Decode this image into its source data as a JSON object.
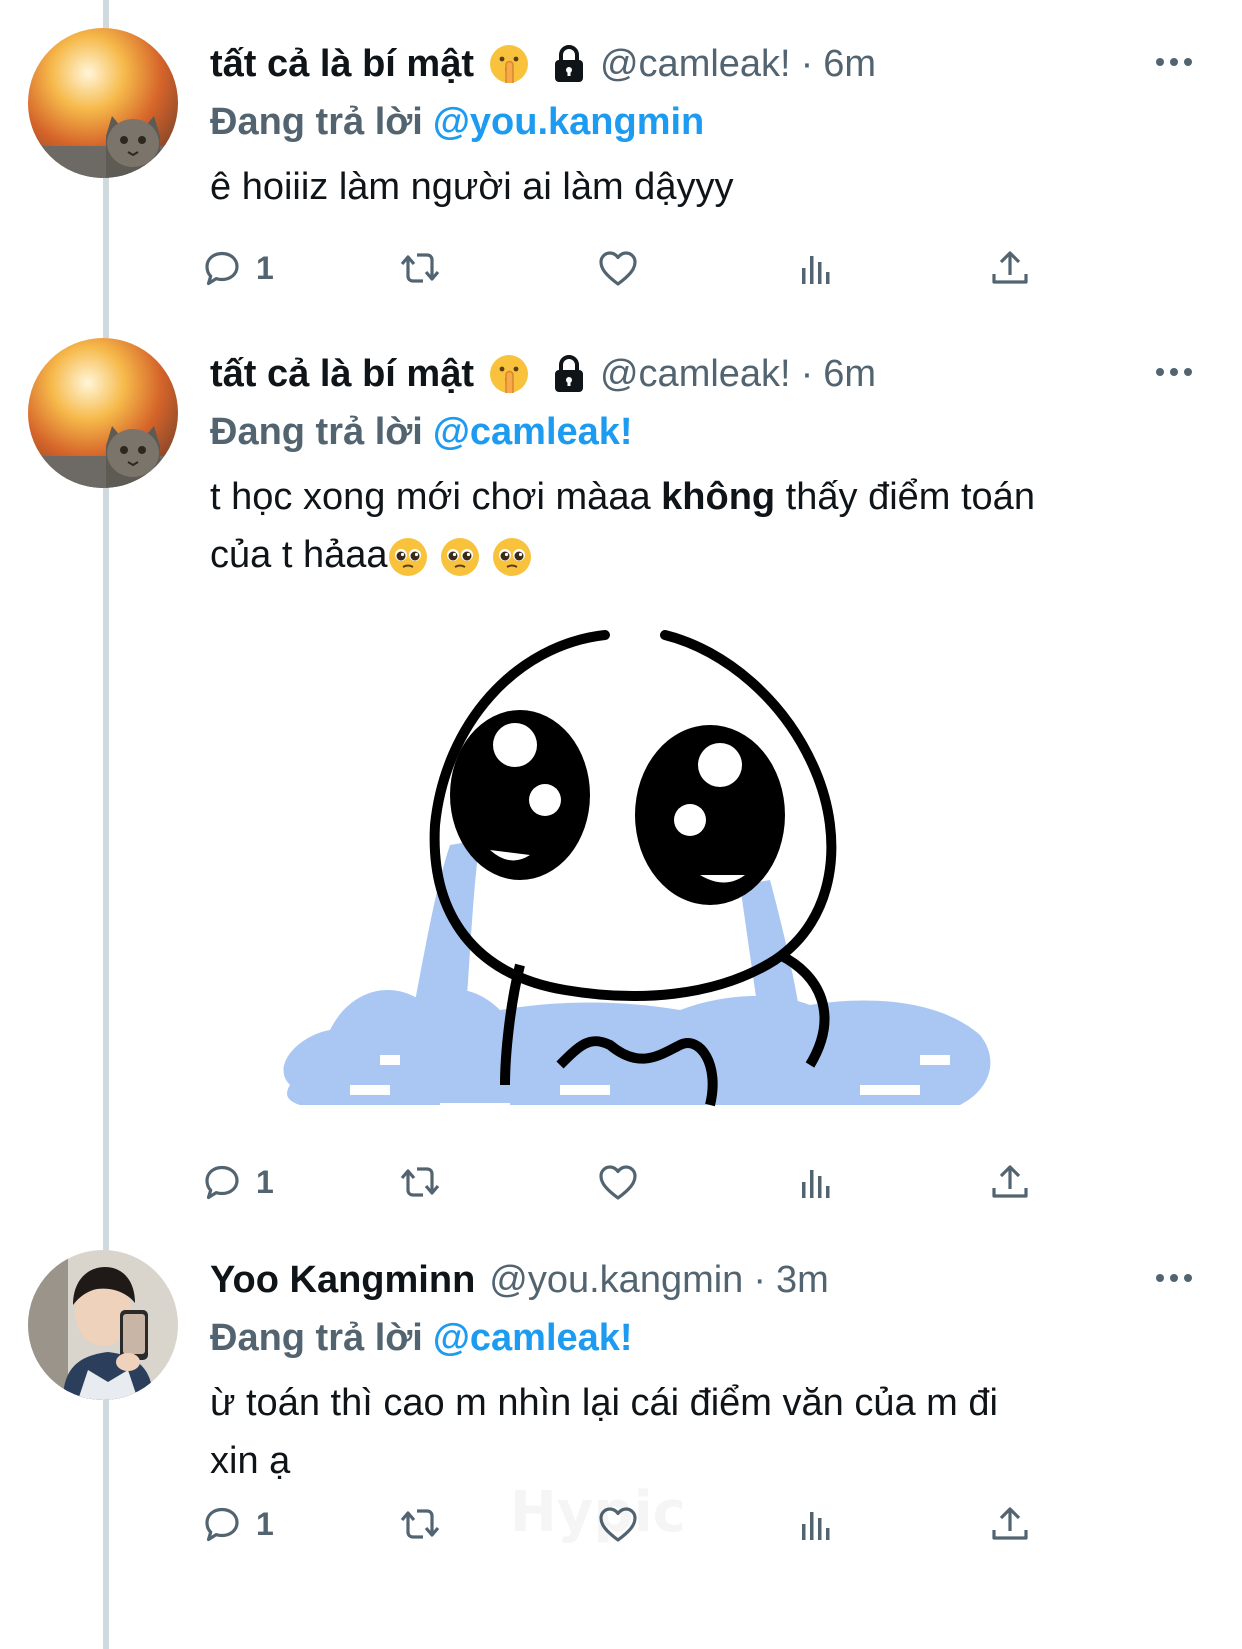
{
  "tweets": [
    {
      "display_name": "tất cả là bí mật",
      "emoji": "shushing-face",
      "protected": true,
      "handle": "@camleak!",
      "separator": "·",
      "time": "6m",
      "reply_prefix": "Đang trả lời",
      "reply_to": "@you.kangmin",
      "text": "ê hoiiiz làm người ai làm dậyyy",
      "reply_count": "1"
    },
    {
      "display_name": "tất cả là bí mật",
      "emoji": "shushing-face",
      "protected": true,
      "handle": "@camleak!",
      "separator": "·",
      "time": "6m",
      "reply_prefix": "Đang trả lời",
      "reply_to": "@camleak!",
      "text_part1": "t học xong mới chơi màaa ",
      "text_bold": "không",
      "text_part2": " thấy điểm toán",
      "text_line2": "của t hảaa",
      "has_image": true,
      "image_description": "crying-cartoon-sticker",
      "reply_count": "1"
    },
    {
      "display_name": "Yoo Kangminn",
      "handle": "@you.kangmin",
      "separator": "·",
      "time": "3m",
      "reply_prefix": "Đang trả lời",
      "reply_to": "@camleak!",
      "text_line1": "ừ toán thì cao m nhìn lại cái điểm văn của m đi",
      "text_line2": "xin ạ",
      "reply_count": "1"
    }
  ],
  "watermark": "Hypic",
  "colors": {
    "accent": "#1d9bf0",
    "secondary_text": "#536471",
    "thread_line": "#cfd9de",
    "tear_blue": "#a9c7f2"
  },
  "icons": [
    "reply-icon",
    "retweet-icon",
    "like-icon",
    "views-icon",
    "share-icon",
    "more-icon",
    "lock-icon"
  ]
}
